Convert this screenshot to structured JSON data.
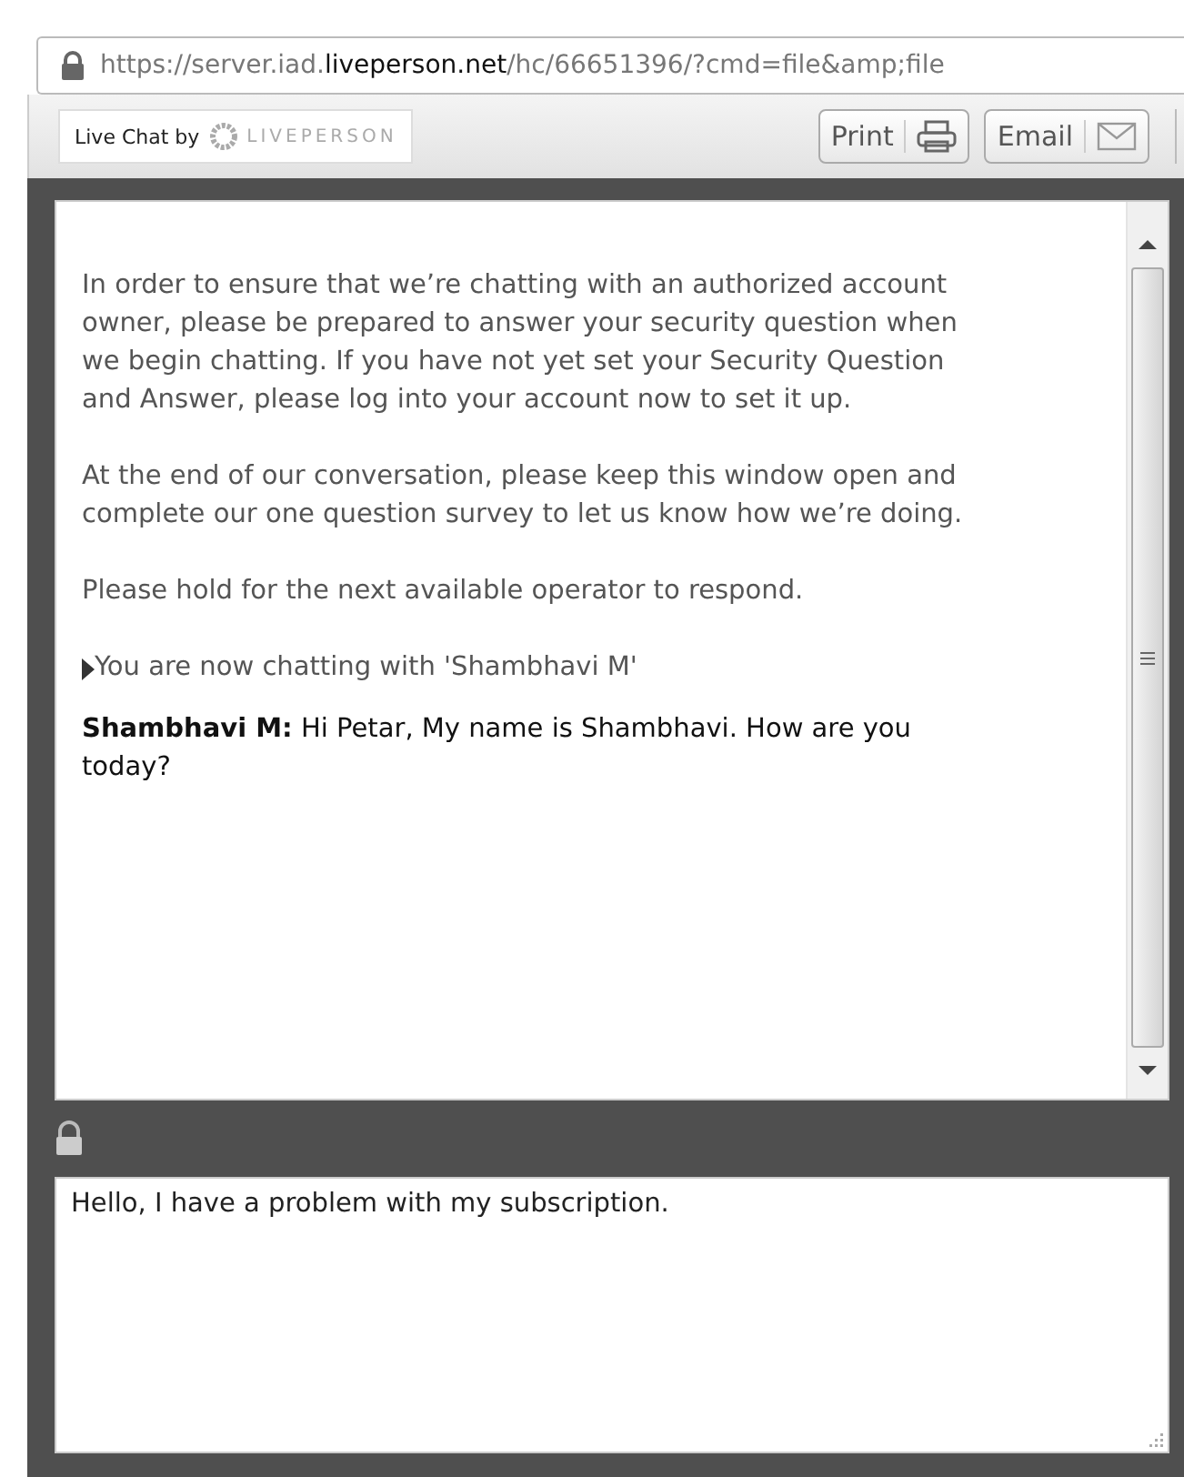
{
  "address_bar": {
    "url": "https://server.iad.**liveperson.net**/hc/66651396/?cmd=file&amp;file"
  },
  "toolbar": {
    "brand_label": "Live Chat by",
    "brand_name": "LIVEPERSON",
    "buttons": [
      {
        "label": "Print",
        "kind": "print"
      },
      {
        "label": "Email",
        "kind": "email"
      }
    ]
  },
  "transcript": [
    {
      "kind": "notice",
      "text": "In order to ensure that we’re chatting with an authorized account owner, please be prepared to answer your security question when we begin chatting. If you have not yet set your Security Question and Answer, please log into your account now to set it up."
    },
    {
      "kind": "notice",
      "text": "At the end of our conversation, please keep this window open and complete our one question survey to let us know how we’re doing."
    },
    {
      "kind": "notice",
      "text": "Please hold for the next available operator to respond."
    },
    {
      "kind": "system",
      "text": "You are now chatting with 'Shambhavi M'"
    },
    {
      "kind": "agent",
      "text": "**Shambhavi M:** Hi Petar, My name is Shambhavi. How are you today?"
    }
  ],
  "message_input": {
    "value": "Hello, I have a problem with my subscription."
  }
}
